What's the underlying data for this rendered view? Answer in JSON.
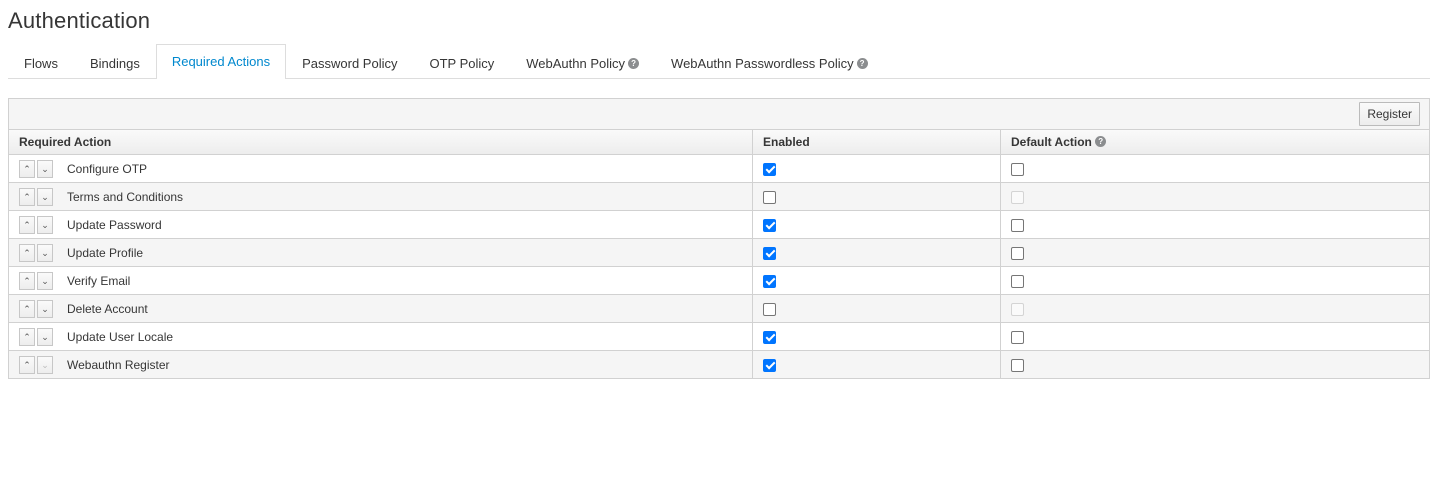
{
  "page": {
    "title": "Authentication"
  },
  "tabs": [
    {
      "label": "Flows",
      "active": false,
      "help": false
    },
    {
      "label": "Bindings",
      "active": false,
      "help": false
    },
    {
      "label": "Required Actions",
      "active": true,
      "help": false
    },
    {
      "label": "Password Policy",
      "active": false,
      "help": false
    },
    {
      "label": "OTP Policy",
      "active": false,
      "help": false
    },
    {
      "label": "WebAuthn Policy",
      "active": false,
      "help": true
    },
    {
      "label": "WebAuthn Passwordless Policy",
      "active": false,
      "help": true
    }
  ],
  "toolbar": {
    "register_label": "Register"
  },
  "table": {
    "headers": {
      "action": "Required Action",
      "enabled": "Enabled",
      "default": "Default Action"
    },
    "up_glyph": "⌃",
    "down_glyph": "⌄",
    "rows": [
      {
        "name": "Configure OTP",
        "enabled": true,
        "default": false,
        "default_disabled": false
      },
      {
        "name": "Terms and Conditions",
        "enabled": false,
        "default": false,
        "default_disabled": true
      },
      {
        "name": "Update Password",
        "enabled": true,
        "default": false,
        "default_disabled": false
      },
      {
        "name": "Update Profile",
        "enabled": true,
        "default": false,
        "default_disabled": false
      },
      {
        "name": "Verify Email",
        "enabled": true,
        "default": false,
        "default_disabled": false
      },
      {
        "name": "Delete Account",
        "enabled": false,
        "default": false,
        "default_disabled": true
      },
      {
        "name": "Update User Locale",
        "enabled": true,
        "default": false,
        "default_disabled": false
      },
      {
        "name": "Webauthn Register",
        "enabled": true,
        "default": false,
        "default_disabled": false
      }
    ]
  },
  "colors": {
    "accent": "#0088ce",
    "checkbox_checked": "#0075ff",
    "border": "#d1d1d1"
  },
  "icons": {
    "help": "question-circle-icon",
    "up": "chevron-up-icon",
    "down": "chevron-down-icon"
  }
}
